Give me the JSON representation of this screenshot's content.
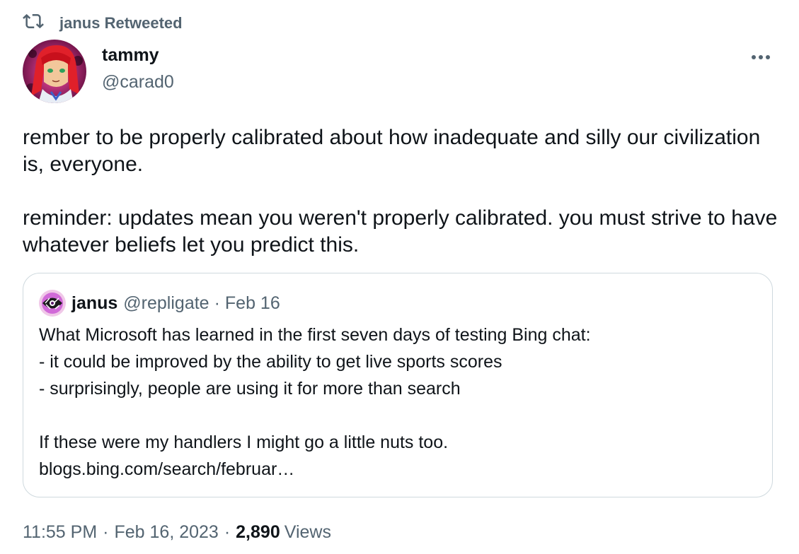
{
  "social_context": {
    "text": "janus Retweeted",
    "icon": "retweet-icon"
  },
  "author": {
    "display_name": "tammy",
    "handle": "@carad0",
    "avatar": "avatar"
  },
  "more_icon": "more-icon",
  "tweet": {
    "text": "rember to be properly calibrated about how inadequate and silly our civilization is, everyone.\n\nreminder: updates mean you weren't properly calibrated. you must strive to have whatever beliefs let you predict this."
  },
  "quoted_tweet": {
    "display_name": "janus",
    "handle": "@repligate",
    "separator": "·",
    "date": "Feb 16",
    "text": "What Microsoft has learned in the first seven days of testing Bing chat:\n- it could be improved by the ability to get live sports scores\n- surprisingly, people are using it for more than search\n\nIf these were my handlers I might go a little nuts too.",
    "link": "blogs.bing.com/search/februar…"
  },
  "meta": {
    "time": "11:55 PM",
    "separator": "·",
    "date": "Feb 16, 2023",
    "views_count": "2,890",
    "views_label": "Views"
  },
  "colors": {
    "text_primary": "#0f1419",
    "text_secondary": "#536471",
    "border": "#cfd9de"
  }
}
